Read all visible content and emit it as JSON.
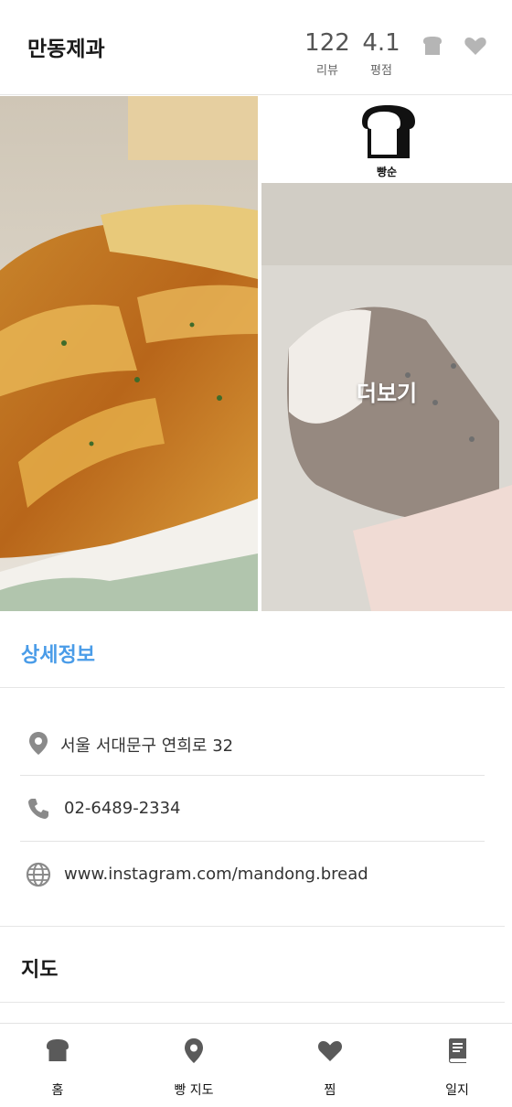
{
  "header": {
    "title": "만동제과",
    "review_count": "122",
    "review_label": "리뷰",
    "rating": "4.1",
    "rating_label": "평점"
  },
  "gallery": {
    "logo_text": "빵순",
    "more_label": "더보기"
  },
  "details": {
    "section_title": "상세정보",
    "address": "서울 서대문구 연희로 32",
    "phone": "02-6489-2334",
    "website": "www.instagram.com/mandong.bread"
  },
  "map": {
    "title": "지도"
  },
  "bottom_nav": {
    "items": [
      {
        "label": "홈",
        "icon": "bread-icon"
      },
      {
        "label": "빵 지도",
        "icon": "location-pin-icon"
      },
      {
        "label": "찜",
        "icon": "heart-icon"
      },
      {
        "label": "일지",
        "icon": "book-icon"
      }
    ]
  },
  "colors": {
    "accent": "#4a9ce8",
    "icon_gray": "#8a8a8a",
    "nav_icon": "#5a5a5a"
  }
}
